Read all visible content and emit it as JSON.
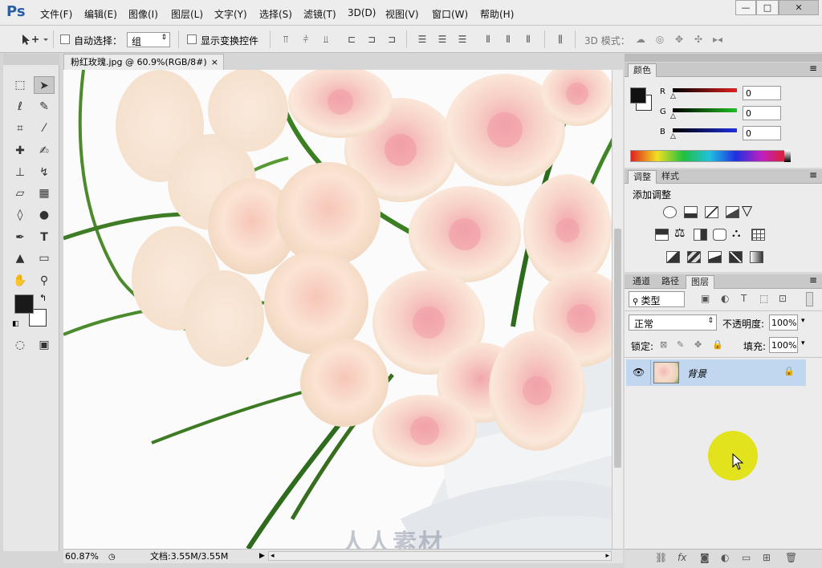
{
  "app": {
    "logo": "Ps",
    "window_buttons": [
      "—",
      "□",
      "✕"
    ]
  },
  "menu": [
    "文件(F)",
    "编辑(E)",
    "图像(I)",
    "图层(L)",
    "文字(Y)",
    "选择(S)",
    "滤镜(T)",
    "3D(D)",
    "视图(V)",
    "窗口(W)",
    "帮助(H)"
  ],
  "options": {
    "auto_select_label": "自动选择：",
    "auto_select_value": "组",
    "transform_label": "显示变换控件",
    "mode_3d_label": "3D 模式："
  },
  "document": {
    "tab_title": "粉红玫瑰.jpg @ 60.9%(RGB/8#)",
    "zoom": "60.87%",
    "doc_size": "文档:3.55M/3.55M"
  },
  "color_panel": {
    "tab": "颜色",
    "channels": [
      {
        "label": "R",
        "value": "0",
        "color": "#e02020"
      },
      {
        "label": "G",
        "value": "0",
        "color": "#20c020"
      },
      {
        "label": "B",
        "value": "0",
        "color": "#2030e0"
      }
    ]
  },
  "adjust_panel": {
    "tabs": [
      "调整",
      "样式"
    ],
    "title": "添加调整"
  },
  "layers_panel": {
    "tabs": [
      "通道",
      "路径",
      "图层"
    ],
    "filter_label": "类型",
    "blend_mode": "正常",
    "opacity_label": "不透明度:",
    "opacity_value": "100%",
    "lock_label": "锁定:",
    "fill_label": "填充:",
    "fill_value": "100%",
    "layer_name": "背景"
  },
  "watermark": "人人素材",
  "colors": {
    "accent": "#2a5fa8",
    "layer_selected": "#c1d6ef",
    "cursor_highlight": "#e0e000"
  }
}
